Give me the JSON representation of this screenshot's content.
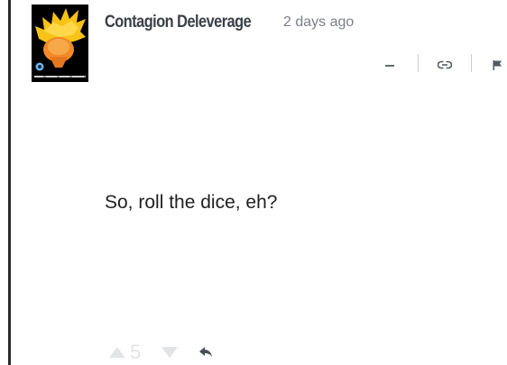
{
  "comment": {
    "author": "Contagion Deleverage",
    "timestamp": "2 days ago",
    "body": "So, roll the dice, eh?",
    "avatar_icon": "meme-avatar-icon",
    "votes": {
      "upvote_icon": "upvote-arrow-icon",
      "count": "5",
      "downvote_icon": "downvote-arrow-icon",
      "reply_icon": "reply-arrow-icon"
    },
    "actions": {
      "collapse_icon": "minus-icon",
      "link_icon": "link-icon",
      "flag_icon": "flag-icon"
    }
  },
  "colors": {
    "thread_line": "#2b2b2b",
    "author": "#3a3f45",
    "timestamp": "#7b7f85",
    "vote_inactive": "#e3e4e6",
    "icon": "#555a60"
  }
}
